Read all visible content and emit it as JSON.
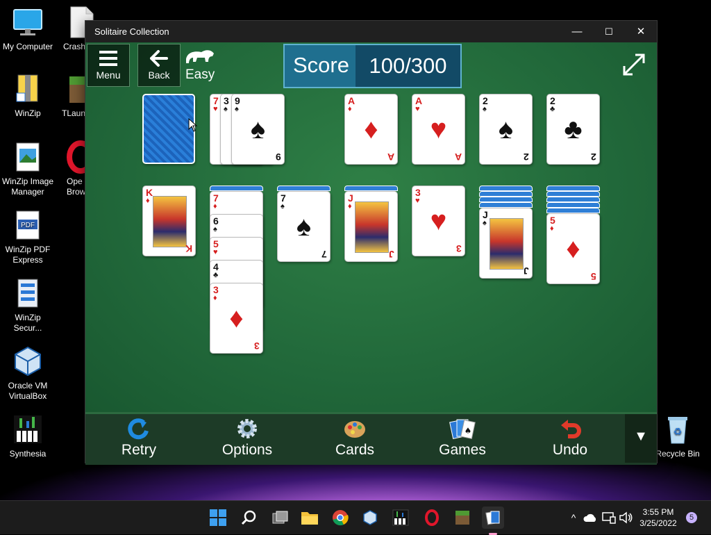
{
  "desktop": {
    "icons": [
      {
        "label": "My Computer"
      },
      {
        "label": "Crash."
      },
      {
        "label": "WinZip"
      },
      {
        "label": "TLaun"
      },
      {
        "label": "WinZip Image Manager"
      },
      {
        "label": "Ope Brow"
      },
      {
        "label": "WinZip PDF Express"
      },
      {
        "label": "WinZip Secur..."
      },
      {
        "label": "Oracle VM VirtualBox"
      },
      {
        "label": "Synthesia"
      },
      {
        "label": "Recycle Bin"
      }
    ]
  },
  "window": {
    "title": "Solitaire Collection",
    "minimize": "—",
    "maximize": "☐",
    "close": "✕"
  },
  "game": {
    "menu_label": "Menu",
    "back_label": "Back",
    "difficulty": "Easy",
    "score_label": "Score",
    "score_value": "100/300",
    "stock": {
      "face_down": true
    },
    "waste": [
      {
        "rank": "7",
        "suit": "♥",
        "color": "red"
      },
      {
        "rank": "3",
        "suit": "♠",
        "color": "black"
      },
      {
        "rank": "9",
        "suit": "♠",
        "color": "black"
      }
    ],
    "foundations": [
      {
        "rank": "A",
        "suit": "♦",
        "color": "red"
      },
      {
        "rank": "A",
        "suit": "♥",
        "color": "red"
      },
      {
        "rank": "2",
        "suit": "♠",
        "color": "black"
      },
      {
        "rank": "2",
        "suit": "♣",
        "color": "black"
      }
    ],
    "tableau": [
      {
        "hidden": 0,
        "cards": [
          {
            "rank": "K",
            "suit": "♦",
            "color": "red",
            "face": true
          }
        ]
      },
      {
        "hidden": 1,
        "cards": [
          {
            "rank": "7",
            "suit": "♦",
            "color": "red"
          },
          {
            "rank": "6",
            "suit": "♠",
            "color": "black"
          },
          {
            "rank": "5",
            "suit": "♥",
            "color": "red"
          },
          {
            "rank": "4",
            "suit": "♣",
            "color": "black"
          },
          {
            "rank": "3",
            "suit": "♦",
            "color": "red"
          }
        ]
      },
      {
        "hidden": 1,
        "cards": [
          {
            "rank": "7",
            "suit": "♠",
            "color": "black"
          }
        ]
      },
      {
        "hidden": 1,
        "cards": [
          {
            "rank": "J",
            "suit": "♦",
            "color": "red",
            "face": true
          }
        ]
      },
      {
        "hidden": 0,
        "cards": [
          {
            "rank": "3",
            "suit": "♥",
            "color": "red"
          }
        ]
      },
      {
        "hidden": 4,
        "cards": [
          {
            "rank": "J",
            "suit": "♠",
            "color": "black",
            "face": true
          }
        ]
      },
      {
        "hidden": 5,
        "cards": [
          {
            "rank": "5",
            "suit": "♦",
            "color": "red"
          }
        ]
      }
    ]
  },
  "toolbar": {
    "items": [
      {
        "label": "Retry",
        "icon": "retry-icon"
      },
      {
        "label": "Options",
        "icon": "gear-icon"
      },
      {
        "label": "Cards",
        "icon": "palette-icon"
      },
      {
        "label": "Games",
        "icon": "cards-icon"
      },
      {
        "label": "Undo",
        "icon": "undo-icon"
      }
    ],
    "collapse": "▼"
  },
  "taskbar": {
    "time": "3:55 PM",
    "date": "3/25/2022",
    "notifications": "5",
    "tray_chevron": "^"
  }
}
